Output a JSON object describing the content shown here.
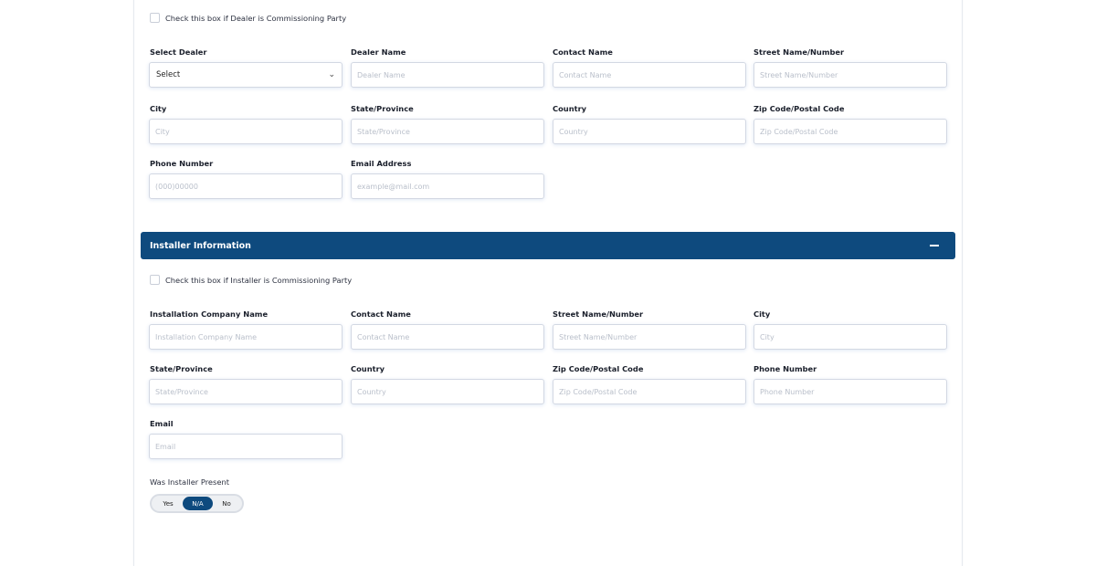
{
  "dealer": {
    "checkbox_label": "Check this box if Dealer is Commissioning Party",
    "select_dealer": {
      "label": "Select Dealer",
      "value": "Select"
    },
    "fields": [
      {
        "label": "Dealer Name",
        "placeholder": "Dealer Name"
      },
      {
        "label": "Contact Name",
        "placeholder": "Contact Name"
      },
      {
        "label": "Street Name/Number",
        "placeholder": "Street Name/Number"
      },
      {
        "label": "City",
        "placeholder": "City"
      },
      {
        "label": "State/Province",
        "placeholder": "State/Province"
      },
      {
        "label": "Country",
        "placeholder": "Country"
      },
      {
        "label": "Zip Code/Postal Code",
        "placeholder": "Zip Code/Postal Code"
      },
      {
        "label": "Phone Number",
        "placeholder": "(000)00000"
      },
      {
        "label": "Email Address",
        "placeholder": "example@mail.com"
      }
    ]
  },
  "installer": {
    "section_title": "Installer Information",
    "collapse_icon": "minus-icon",
    "checkbox_label": "Check this box if Installer is Commissioning Party",
    "fields": [
      {
        "label": "Installation Company Name",
        "placeholder": "Installation Company Name"
      },
      {
        "label": "Contact Name",
        "placeholder": "Contact Name"
      },
      {
        "label": "Street Name/Number",
        "placeholder": "Street Name/Number"
      },
      {
        "label": "City",
        "placeholder": "City"
      },
      {
        "label": "State/Province",
        "placeholder": "State/Province"
      },
      {
        "label": "Country",
        "placeholder": "Country"
      },
      {
        "label": "Zip Code/Postal Code",
        "placeholder": "Zip Code/Postal Code"
      },
      {
        "label": "Phone Number",
        "placeholder": "Phone Number"
      },
      {
        "label": "Email",
        "placeholder": "Email"
      }
    ],
    "present_question": "Was Installer Present",
    "present_options": [
      "Yes",
      "N/A",
      "No"
    ],
    "present_selected": "N/A"
  },
  "colors": {
    "section_bar": "#0e4a7e",
    "toggle_active": "#0e4a7e"
  }
}
